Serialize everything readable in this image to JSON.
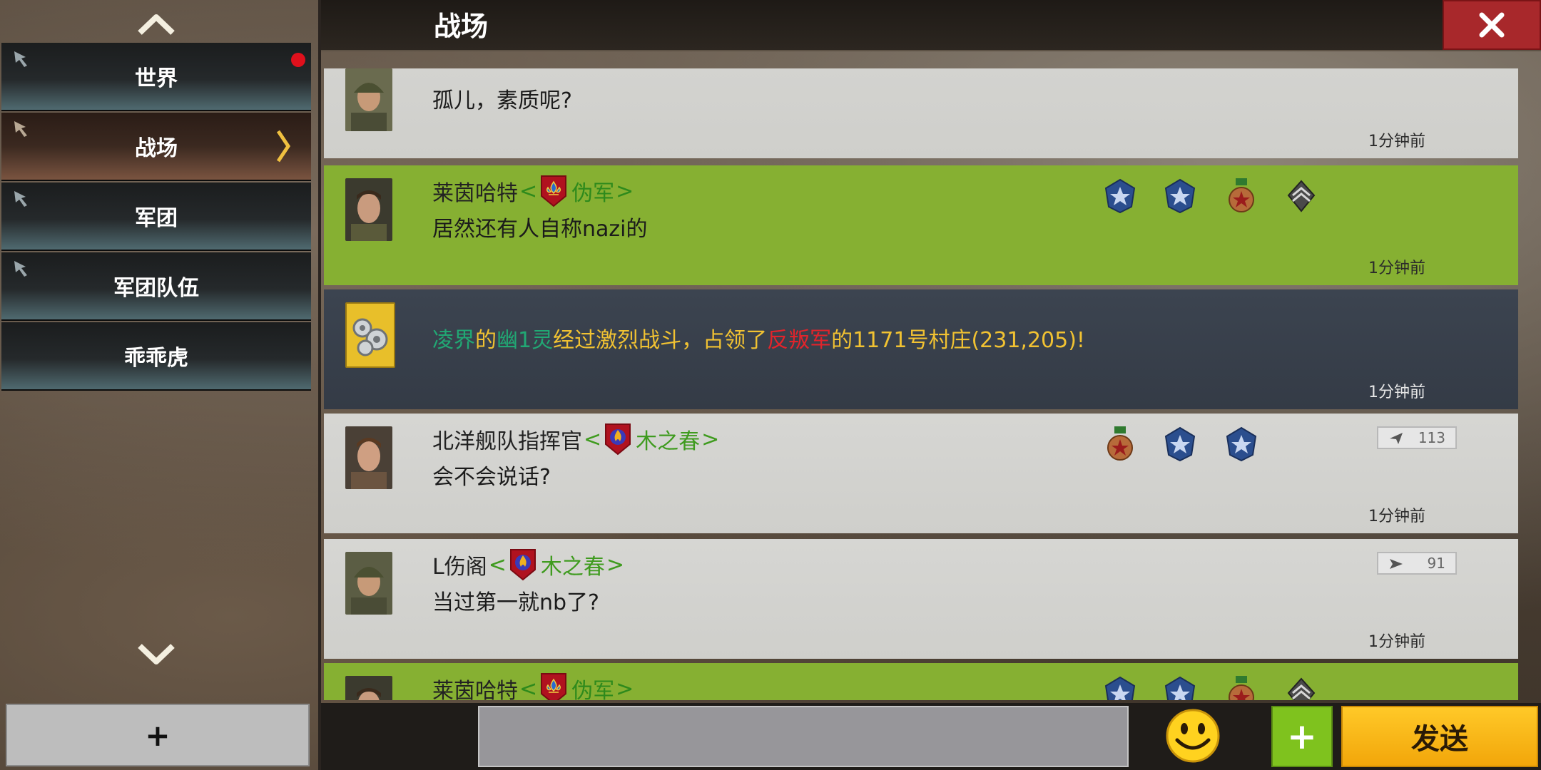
{
  "header": {
    "title": "战场",
    "close_icon": "close-icon"
  },
  "sidebar": {
    "channels": [
      {
        "label": "世界",
        "pinned": true,
        "unread": true
      },
      {
        "label": "战场",
        "pinned": true,
        "active": true
      },
      {
        "label": "军团",
        "pinned": true
      },
      {
        "label": "军团队伍",
        "pinned": true
      },
      {
        "label": "乖乖虎",
        "pinned": false
      }
    ],
    "add_label": "+"
  },
  "messages": [
    {
      "type": "player",
      "style": "gray",
      "text": "孤儿，素质呢?",
      "time": "1分钟前"
    },
    {
      "type": "player",
      "style": "green",
      "name": "莱茵哈特",
      "guild": "伪军",
      "text": "居然还有人自称nazi的",
      "time": "1分钟前"
    },
    {
      "type": "system",
      "parts": [
        "凌界",
        "的",
        "幽1灵",
        "经过激烈战斗，占领了",
        "反叛军",
        "的1171号村庄(231,205)!"
      ],
      "time": "1分钟前"
    },
    {
      "type": "player",
      "style": "gray",
      "name": "北洋舰队指挥官",
      "guild": "木之春",
      "text": "会不会说话?",
      "rank": "113",
      "time": "1分钟前"
    },
    {
      "type": "player",
      "style": "gray",
      "name": "L伤阁",
      "guild": "木之春",
      "text": "当过第一就nb了?",
      "rank": "91",
      "time": "1分钟前"
    },
    {
      "type": "player",
      "style": "green",
      "name": "莱茵哈特",
      "guild": "伪军"
    }
  ],
  "guild_brackets": {
    "open": "<",
    "close": ">"
  },
  "input": {
    "placeholder": ""
  },
  "actions": {
    "plus_label": "+",
    "send_label": "发送"
  },
  "colors": {
    "green_row": "#86b032",
    "system_row": "#3c4450",
    "send": "#f7b81a",
    "close": "#a8282b"
  }
}
